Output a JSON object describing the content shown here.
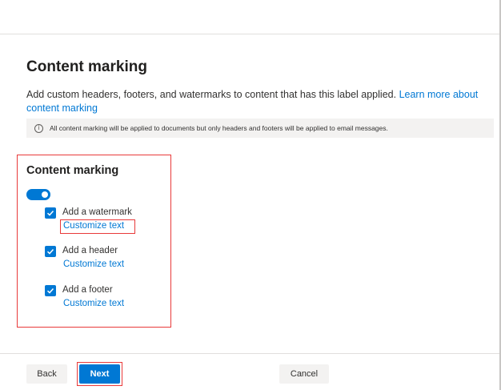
{
  "page": {
    "title": "Content marking",
    "description": "Add custom headers, footers, and watermarks to content that has this label applied.",
    "learn_more_link": "Learn more about content marking",
    "info_text": "All content marking will be applied to documents but only headers and footers will be applied to email messages.",
    "info_icon": "info-icon"
  },
  "section": {
    "title": "Content marking",
    "toggle_on": true,
    "options": [
      {
        "label": "Add a watermark",
        "checked": true,
        "link": "Customize text"
      },
      {
        "label": "Add a header",
        "checked": true,
        "link": "Customize text"
      },
      {
        "label": "Add a footer",
        "checked": true,
        "link": "Customize text"
      }
    ]
  },
  "footer": {
    "back_label": "Back",
    "next_label": "Next",
    "cancel_label": "Cancel"
  },
  "colors": {
    "accent": "#0078d4",
    "highlight": "#e83a3a",
    "info_bg": "#f3f2f1"
  }
}
